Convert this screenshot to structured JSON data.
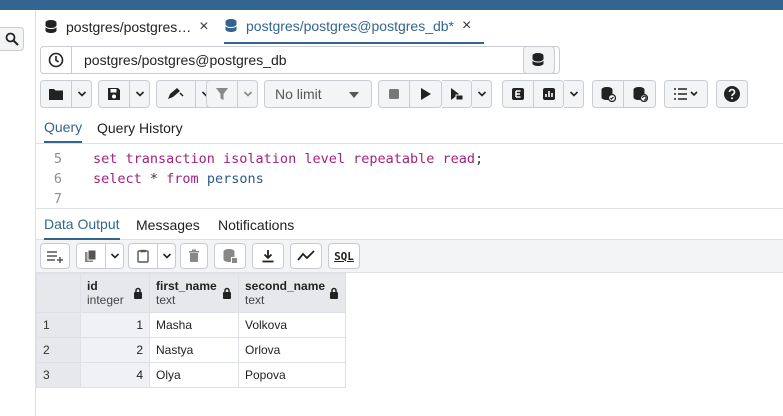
{
  "tabs": [
    {
      "label": "postgres/postgres…",
      "close": "×"
    },
    {
      "label": "postgres/postgres@postgres_db*",
      "close": "×"
    }
  ],
  "connection": {
    "value": "postgres/postgres@postgres_db"
  },
  "toolbar": {
    "limit_label": "No limit"
  },
  "query_tabs": [
    {
      "label": "Query"
    },
    {
      "label": "Query History"
    }
  ],
  "editor": {
    "lines": [
      {
        "number": "5",
        "tokens": [
          {
            "text": "set transaction isolation level repeatable read",
            "kind": "kw"
          },
          {
            "text": ";",
            "kind": "plain"
          }
        ]
      },
      {
        "number": "6",
        "tokens": [
          {
            "text": "select",
            "kind": "kw"
          },
          {
            "text": " * ",
            "kind": "plain"
          },
          {
            "text": "from",
            "kind": "kw"
          },
          {
            "text": " persons",
            "kind": "id"
          }
        ]
      },
      {
        "number": "7",
        "tokens": []
      }
    ]
  },
  "output_tabs": [
    {
      "label": "Data Output"
    },
    {
      "label": "Messages"
    },
    {
      "label": "Notifications"
    }
  ],
  "grid_toolbar": {
    "sql_label": "SQL"
  },
  "results": {
    "columns": [
      {
        "name": "id",
        "type": "integer"
      },
      {
        "name": "first_name",
        "type": "text"
      },
      {
        "name": "second_name",
        "type": "text"
      }
    ],
    "rows": [
      {
        "row": "1",
        "id": "1",
        "first_name": "Masha",
        "second_name": "Volkova"
      },
      {
        "row": "2",
        "id": "2",
        "first_name": "Nastya",
        "second_name": "Orlova"
      },
      {
        "row": "3",
        "id": "4",
        "first_name": "Olya",
        "second_name": "Popova"
      }
    ]
  },
  "colors": {
    "accent": "#326690",
    "keyword": "#a3227e",
    "identifier": "#2b5a8a"
  }
}
